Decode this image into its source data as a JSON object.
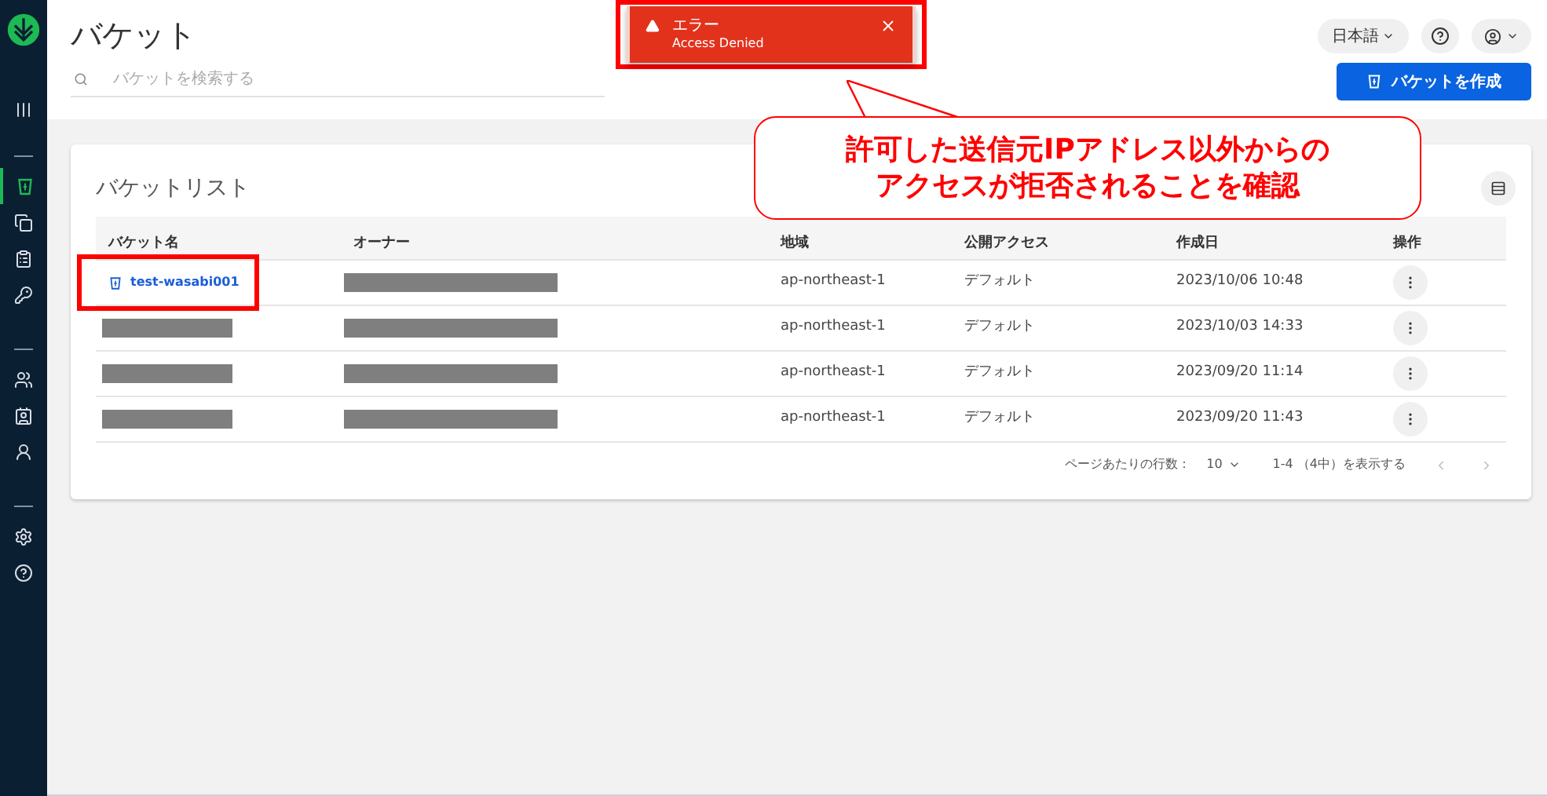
{
  "sidebar": {
    "nav": [
      {
        "selected": true
      },
      {
        "selected": false
      },
      {
        "selected": false
      },
      {
        "selected": false
      },
      {
        "selected": false
      },
      {
        "selected": false
      },
      {
        "selected": false
      },
      {
        "selected": false
      },
      {
        "selected": false
      }
    ]
  },
  "header": {
    "title": "バケット",
    "search": {
      "placeholder": "バケットを検索する"
    },
    "language": "日本語",
    "create_button": "バケットを作成"
  },
  "toast": {
    "title": "エラー",
    "message": "Access Denied"
  },
  "callout": {
    "lines": [
      "許可した送信元IPアドレス以外からの",
      "アクセスが拒否されることを確認"
    ]
  },
  "card": {
    "title": "バケットリスト",
    "table": {
      "columns": [
        "バケット名",
        "オーナー",
        "地域",
        "公開アクセス",
        "作成日",
        "操作"
      ],
      "rows": [
        {
          "name": {
            "kind": "link",
            "text": "test-wasabi001"
          },
          "highlighted": true,
          "owner": {
            "kind": "redacted"
          },
          "region": "ap-northeast-1",
          "access": "デフォルト",
          "created": "2023/10/06 10:48"
        },
        {
          "name": {
            "kind": "redacted"
          },
          "highlighted": false,
          "owner": {
            "kind": "redacted"
          },
          "region": "ap-northeast-1",
          "access": "デフォルト",
          "created": "2023/10/03 14:33"
        },
        {
          "name": {
            "kind": "redacted"
          },
          "highlighted": false,
          "owner": {
            "kind": "redacted"
          },
          "region": "ap-northeast-1",
          "access": "デフォルト",
          "created": "2023/09/20 11:14"
        },
        {
          "name": {
            "kind": "redacted"
          },
          "highlighted": false,
          "owner": {
            "kind": "redacted"
          },
          "region": "ap-northeast-1",
          "access": "デフォルト",
          "created": "2023/09/20 11:43"
        }
      ]
    },
    "pagination": {
      "rows_per_page_label": "ページあたりの行数：",
      "rows_per_page": "10",
      "range": "1-4 （4中）を表示する"
    }
  }
}
